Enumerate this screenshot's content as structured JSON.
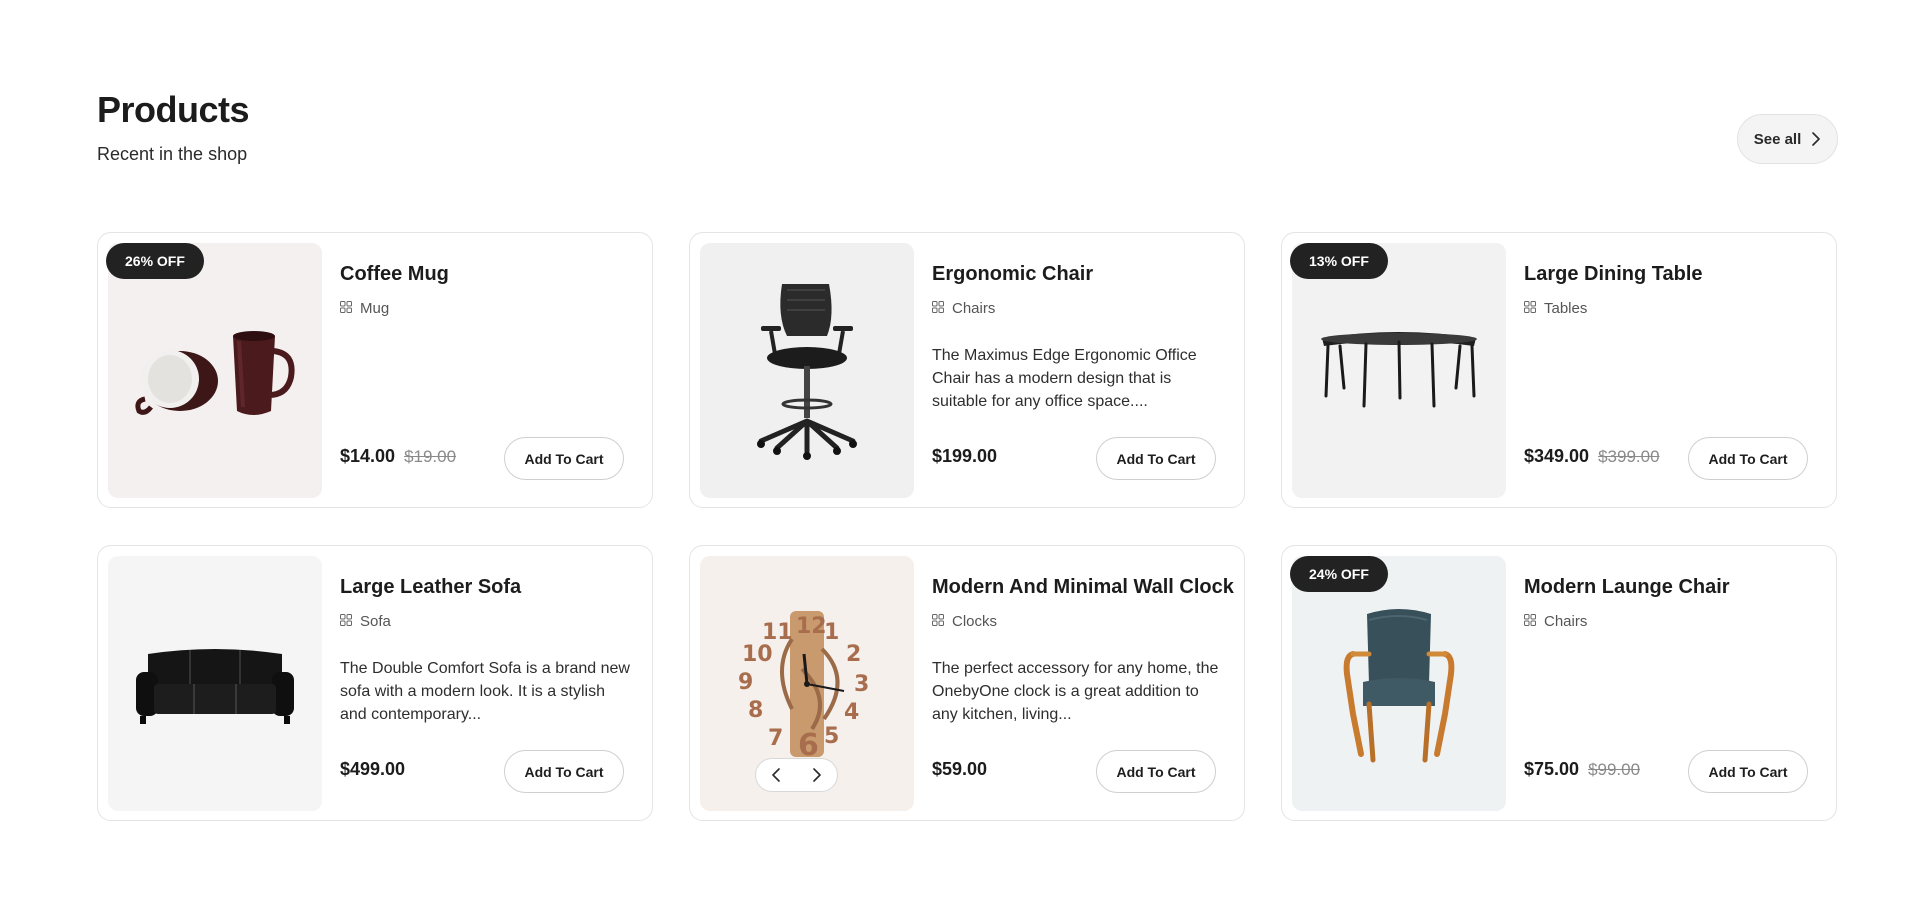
{
  "header": {
    "title": "Products",
    "subtitle": "Recent in the shop",
    "see_all_label": "See all"
  },
  "colors": {
    "badge_bg": "#222222",
    "text": "#1c1c1c",
    "muted": "#8a8a8a"
  },
  "products": [
    {
      "name": "Coffee Mug",
      "category": "Mug",
      "description": "",
      "price": "$14.00",
      "old_price": "$19.00",
      "badge": "26% OFF",
      "button": "Add To Cart",
      "image": "coffee-mug-image"
    },
    {
      "name": "Ergonomic Chair",
      "category": "Chairs",
      "description": "The Maximus Edge Ergonomic Office Chair has a modern design that is suitable for any office space....",
      "price": "$199.00",
      "old_price": "",
      "badge": "",
      "button": "Add To Cart",
      "image": "office-chair-image"
    },
    {
      "name": "Large Dining Table",
      "category": "Tables",
      "description": "",
      "price": "$349.00",
      "old_price": "$399.00",
      "badge": "13% OFF",
      "button": "Add To Cart",
      "image": "dining-table-image"
    },
    {
      "name": "Large Leather Sofa",
      "category": "Sofa",
      "description": "The Double Comfort Sofa is a brand new sofa with a modern look. It is a stylish and contemporary...",
      "price": "$499.00",
      "old_price": "",
      "badge": "",
      "button": "Add To Cart",
      "image": "leather-sofa-image"
    },
    {
      "name": "Modern And Minimal Wall Clock",
      "category": "Clocks",
      "description": "The perfect accessory for any home, the OnebyOne clock is a great addition to any kitchen, living...",
      "price": "$59.00",
      "old_price": "",
      "badge": "",
      "button": "Add To Cart",
      "image": "wall-clock-image"
    },
    {
      "name": "Modern Launge Chair",
      "category": "Chairs",
      "description": "",
      "price": "$75.00",
      "old_price": "$99.00",
      "badge": "24% OFF",
      "button": "Add To Cart",
      "image": "lounge-chair-image"
    }
  ]
}
